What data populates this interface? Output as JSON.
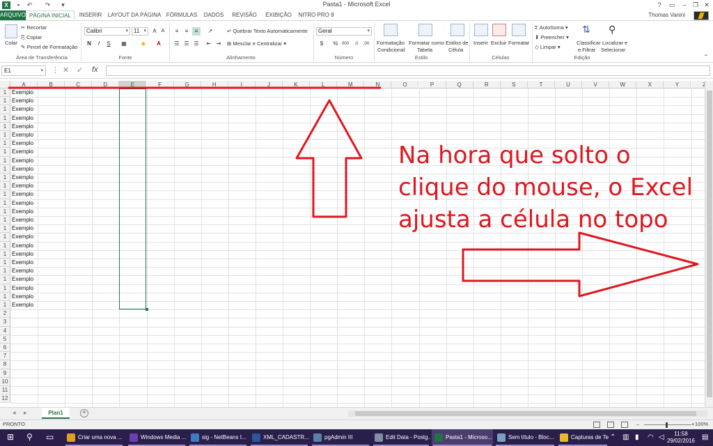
{
  "window": {
    "title": "Pasta1 - Microsoft Excel",
    "user": "Thomas Vanini"
  },
  "tabs": [
    "ARQUIVO",
    "PÁGINA INICIAL",
    "INSERIR",
    "LAYOUT DA PÁGINA",
    "FÓRMULAS",
    "DADOS",
    "REVISÃO",
    "EXIBIÇÃO",
    "NITRO PRO 9"
  ],
  "ribbon": {
    "clipboard": {
      "paste": "Colar",
      "cut": "Recortar",
      "copy": "Copiar",
      "format_painter": "Pincel de Formatação",
      "label": "Área de Transferência"
    },
    "font": {
      "name": "Calibri",
      "size": "11",
      "bold": "N",
      "italic": "I",
      "underline": "S",
      "label": "Fonte"
    },
    "alignment": {
      "wrap": "Quebrar Texto Automaticamente",
      "merge": "Mesclar e Centralizar",
      "label": "Alinhamento"
    },
    "number": {
      "format": "Geral",
      "label": "Número"
    },
    "styles": {
      "conditional_1": "Formatação",
      "conditional_2": "Condicional",
      "table_1": "Formatar como",
      "table_2": "Tabela",
      "cell_1": "Estilos de",
      "cell_2": "Célula",
      "label": "Estilo"
    },
    "cells": {
      "insert": "Inserir",
      "delete": "Excluir",
      "format": "Formatar",
      "label": "Células"
    },
    "editing": {
      "autosum": "AutoSoma",
      "fill": "Preencher",
      "clear": "Limpar",
      "sort_1": "Classificar",
      "sort_2": "e Filtrar",
      "find_1": "Localizar e",
      "find_2": "Selecionar",
      "label": "Edição"
    }
  },
  "formula_bar": {
    "name_box": "E1",
    "value": ""
  },
  "grid": {
    "columns": [
      "A",
      "B",
      "C",
      "D",
      "E",
      "F",
      "G",
      "H",
      "I",
      "J",
      "K",
      "L",
      "M",
      "N",
      "O",
      "P",
      "Q",
      "R",
      "S",
      "T",
      "U",
      "V",
      "W",
      "X",
      "Y",
      "Z"
    ],
    "selected_column": "E",
    "rows_with_data": [
      1,
      1,
      1,
      1,
      1,
      1,
      1,
      1,
      1,
      1,
      1,
      1,
      1,
      1,
      1,
      1,
      1,
      1,
      1,
      1,
      1,
      1,
      1,
      1,
      1,
      1
    ],
    "visible_row_numbers": [
      "1",
      "2",
      "3",
      "4",
      "5",
      "6",
      "7",
      "8",
      "9",
      "10",
      "11",
      "12"
    ],
    "cell_value": "Exemplo"
  },
  "sheets": {
    "active": "Plan1"
  },
  "status": {
    "mode": "PRONTO",
    "zoom": "100%"
  },
  "annotation": {
    "text": "Na hora que solto o clique do mouse, o Excel ajusta a célula no topo",
    "color": "#e0161e"
  },
  "taskbar": {
    "items": [
      {
        "label": "Criar uma nova ...",
        "color": "#e0a020"
      },
      {
        "label": "Windows Media ...",
        "color": "#6a3fb0"
      },
      {
        "label": "sig - NetBeans I...",
        "color": "#3b7dc0"
      },
      {
        "label": "XML_CADASTR...",
        "color": "#2b579a"
      },
      {
        "label": "pgAdmin III",
        "color": "#5a7fa8"
      },
      {
        "label": "Edit Data - Postg...",
        "color": "#8090a0"
      },
      {
        "label": "Pasta1 - Microso...",
        "color": "#217346"
      },
      {
        "label": "Sem título - Bloc...",
        "color": "#7aa0c0"
      },
      {
        "label": "Capturas de Tela",
        "color": "#e8b830"
      }
    ],
    "time": "11:58",
    "date": "29/02/2016"
  }
}
